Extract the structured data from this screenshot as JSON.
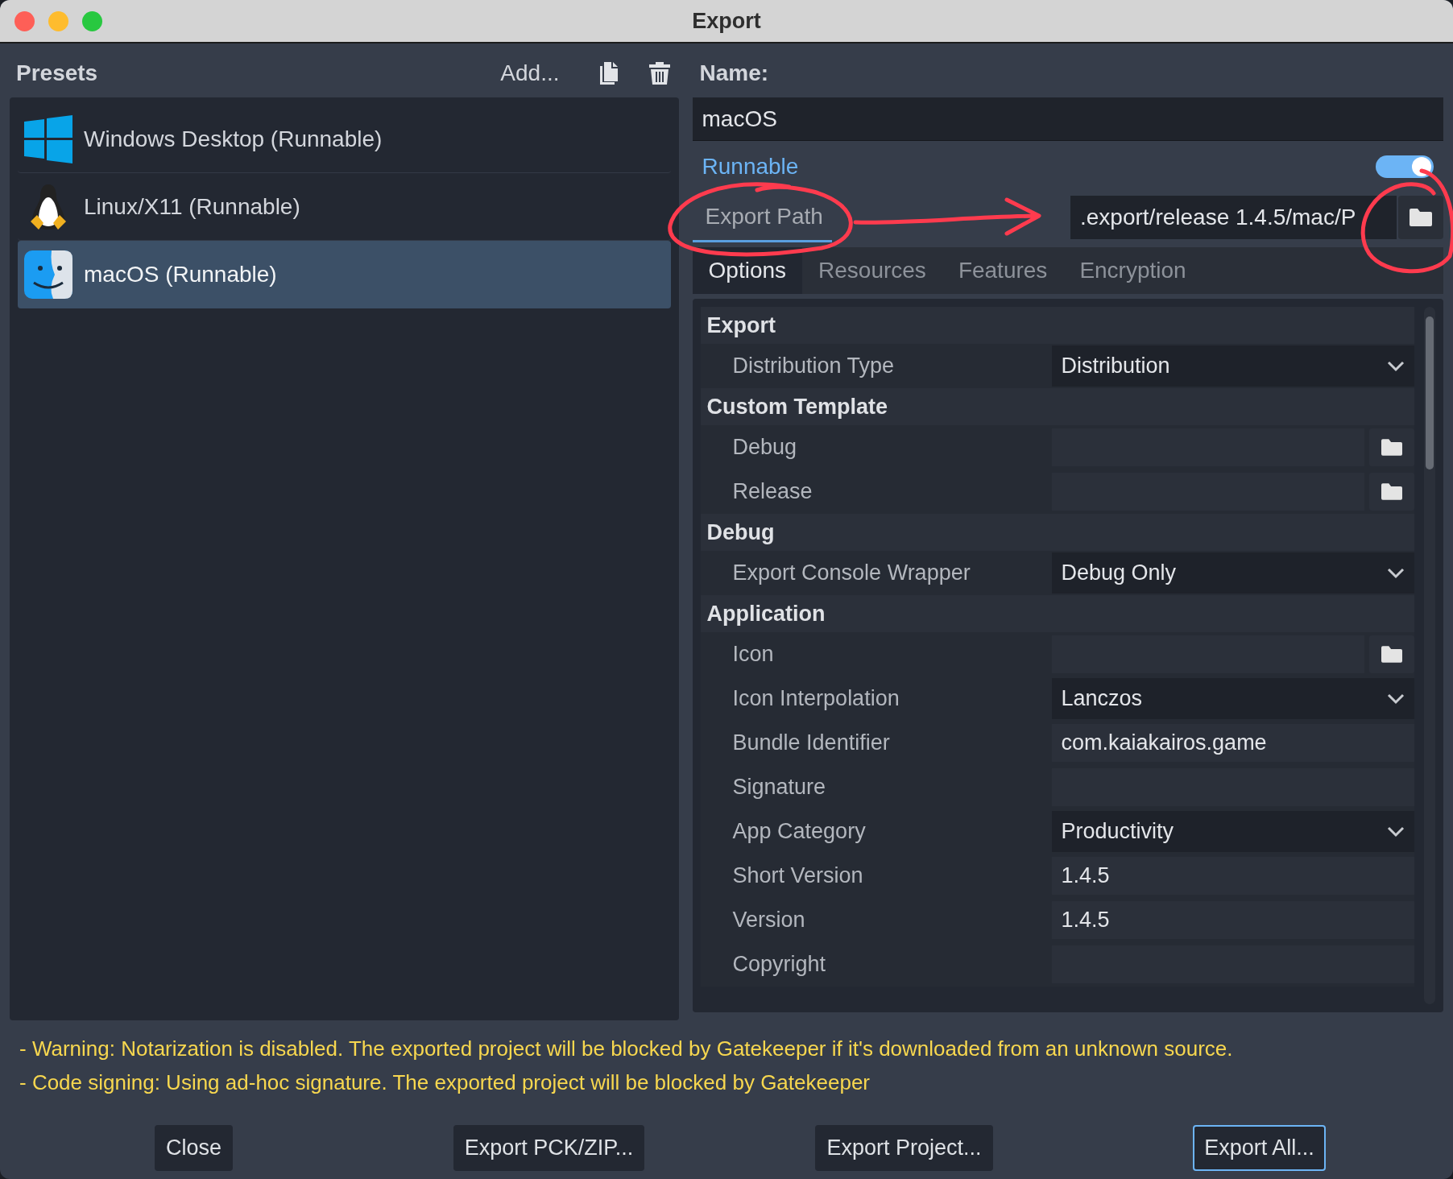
{
  "window": {
    "title": "Export"
  },
  "presets": {
    "title": "Presets",
    "add_label": "Add...",
    "items": [
      {
        "name": "Windows Desktop (Runnable)",
        "kind": "windows",
        "selected": false
      },
      {
        "name": "Linux/X11 (Runnable)",
        "kind": "linux",
        "selected": false
      },
      {
        "name": "macOS (Runnable)",
        "kind": "macos",
        "selected": true
      }
    ]
  },
  "name": {
    "label": "Name:",
    "value": "macOS"
  },
  "runnable": {
    "label": "Runnable",
    "on": true
  },
  "export_path": {
    "label": "Export Path",
    "value": ".export/release 1.4.5/mac/P"
  },
  "tabs": [
    {
      "label": "Options",
      "selected": true
    },
    {
      "label": "Resources",
      "selected": false
    },
    {
      "label": "Features",
      "selected": false
    },
    {
      "label": "Encryption",
      "selected": false
    }
  ],
  "options": [
    {
      "kind": "section",
      "label": "Export"
    },
    {
      "kind": "select",
      "label": "Distribution Type",
      "value": "Distribution"
    },
    {
      "kind": "section",
      "label": "Custom Template"
    },
    {
      "kind": "file",
      "label": "Debug"
    },
    {
      "kind": "file",
      "label": "Release"
    },
    {
      "kind": "section",
      "label": "Debug"
    },
    {
      "kind": "select",
      "label": "Export Console Wrapper",
      "value": "Debug Only"
    },
    {
      "kind": "section",
      "label": "Application"
    },
    {
      "kind": "file",
      "label": "Icon"
    },
    {
      "kind": "select",
      "label": "Icon Interpolation",
      "value": "Lanczos"
    },
    {
      "kind": "text",
      "label": "Bundle Identifier",
      "value": "com.kaiakairos.game"
    },
    {
      "kind": "text",
      "label": "Signature"
    },
    {
      "kind": "select",
      "label": "App Category",
      "value": "Productivity"
    },
    {
      "kind": "text",
      "label": "Short Version",
      "value": "1.4.5"
    },
    {
      "kind": "text",
      "label": "Version",
      "value": "1.4.5"
    },
    {
      "kind": "text",
      "label": "Copyright"
    }
  ],
  "warnings": [
    "- Warning: Notarization is disabled. The exported project will be blocked by Gatekeeper if it's downloaded from an unknown source.",
    "- Code signing: Using ad-hoc signature. The exported project will be blocked by Gatekeeper"
  ],
  "buttons": [
    {
      "label": "Close",
      "focused": false
    },
    {
      "label": "Export PCK/ZIP...",
      "focused": false
    },
    {
      "label": "Export Project...",
      "focused": false
    },
    {
      "label": "Export All...",
      "focused": true
    }
  ]
}
